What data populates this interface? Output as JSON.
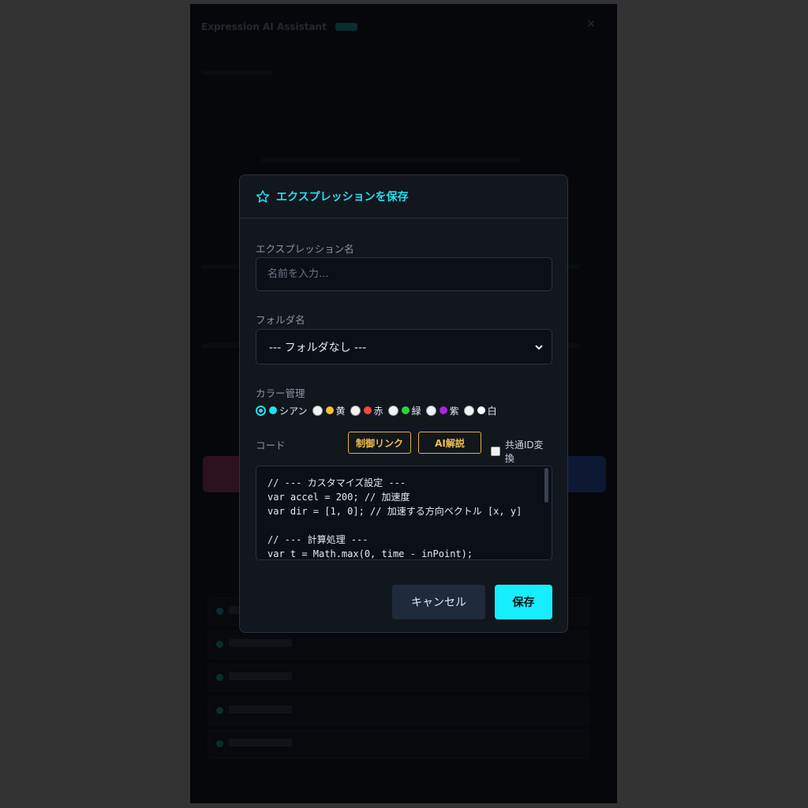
{
  "background_app": {
    "title": "Expression AI Assistant"
  },
  "modal": {
    "title": "エクスプレッションを保存",
    "name_label": "エクスプレッション名",
    "name_placeholder": "名前を入力...",
    "name_value": "",
    "folder_label": "フォルダ名",
    "folder_selected": "--- フォルダなし ---",
    "color_label": "カラー管理",
    "colors": [
      {
        "name": "シアン",
        "hex": "#1fe0f0",
        "checked": true
      },
      {
        "name": "黄",
        "hex": "#f2c030",
        "checked": false
      },
      {
        "name": "赤",
        "hex": "#f04848",
        "checked": false
      },
      {
        "name": "緑",
        "hex": "#28d838",
        "checked": false
      },
      {
        "name": "紫",
        "hex": "#b020e0",
        "checked": false
      },
      {
        "name": "白",
        "hex": "#ffffff",
        "checked": false
      }
    ],
    "code_label": "コード",
    "control_link_label": "制御リンク",
    "ai_explain_label": "AI解説",
    "common_id_label": "共通ID変換",
    "code": "// --- カスタマイズ設定 ---\nvar accel = 200; // 加速度\nvar dir = [1, 0]; // 加速する方向ベクトル [x, y]\n\n// --- 計算処理 ---\nvar t = Math.max(0, time - inPoint);",
    "cancel_label": "キャンセル",
    "save_label": "保存"
  },
  "colors": {
    "accent": "#1fe0f0",
    "warning": "#f2c04a",
    "save_button": "#15eefc"
  }
}
